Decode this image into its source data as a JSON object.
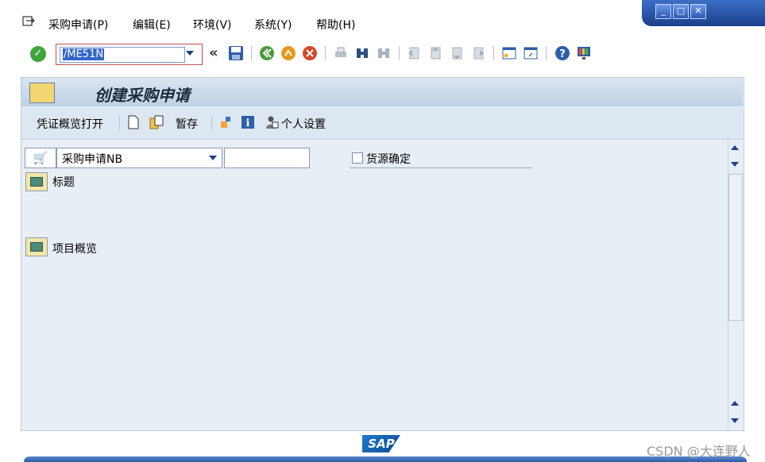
{
  "menu": {
    "items": [
      "采购申请(P)",
      "编辑(E)",
      "环境(V)",
      "系统(Y)",
      "帮助(H)"
    ]
  },
  "toolbar": {
    "command_value": "/ME51N",
    "back_glyph": "«"
  },
  "titlebar": {
    "title": "创建采购申请"
  },
  "app_toolbar": {
    "document_overview": "凭证概览打开",
    "hold": "暂存",
    "personal_settings": "个人设置"
  },
  "content": {
    "doc_type_value": "采购申请NB",
    "source_determination_label": "货源确定",
    "header_label": "标题",
    "item_overview_label": "项目概览"
  },
  "branding": {
    "sap_logo": "SAP",
    "watermark": "CSDN @大连野人"
  },
  "colors": {
    "menu_bg": "#ffffff",
    "panel_bg": "#e7eef5",
    "title_gradient_top": "#dae6f1",
    "selection": "#3366cc",
    "ok_green": "#3ea53a"
  },
  "icons": [
    "menu-page-icon",
    "minimize-icon",
    "maximize-icon",
    "close-icon",
    "enter-check-icon",
    "save-icon",
    "back-icon",
    "exit-icon",
    "cancel-icon",
    "print-icon",
    "find-icon",
    "find-next-icon",
    "first-page-icon",
    "previous-page-icon",
    "next-page-icon",
    "last-page-icon",
    "new-session-icon",
    "shortcut-icon",
    "help-icon",
    "customize-layout-icon",
    "new-document-icon",
    "copy-document-icon",
    "personal-settings-icon",
    "info-icon",
    "hold-icon",
    "cart-icon",
    "expand-section-icon"
  ]
}
